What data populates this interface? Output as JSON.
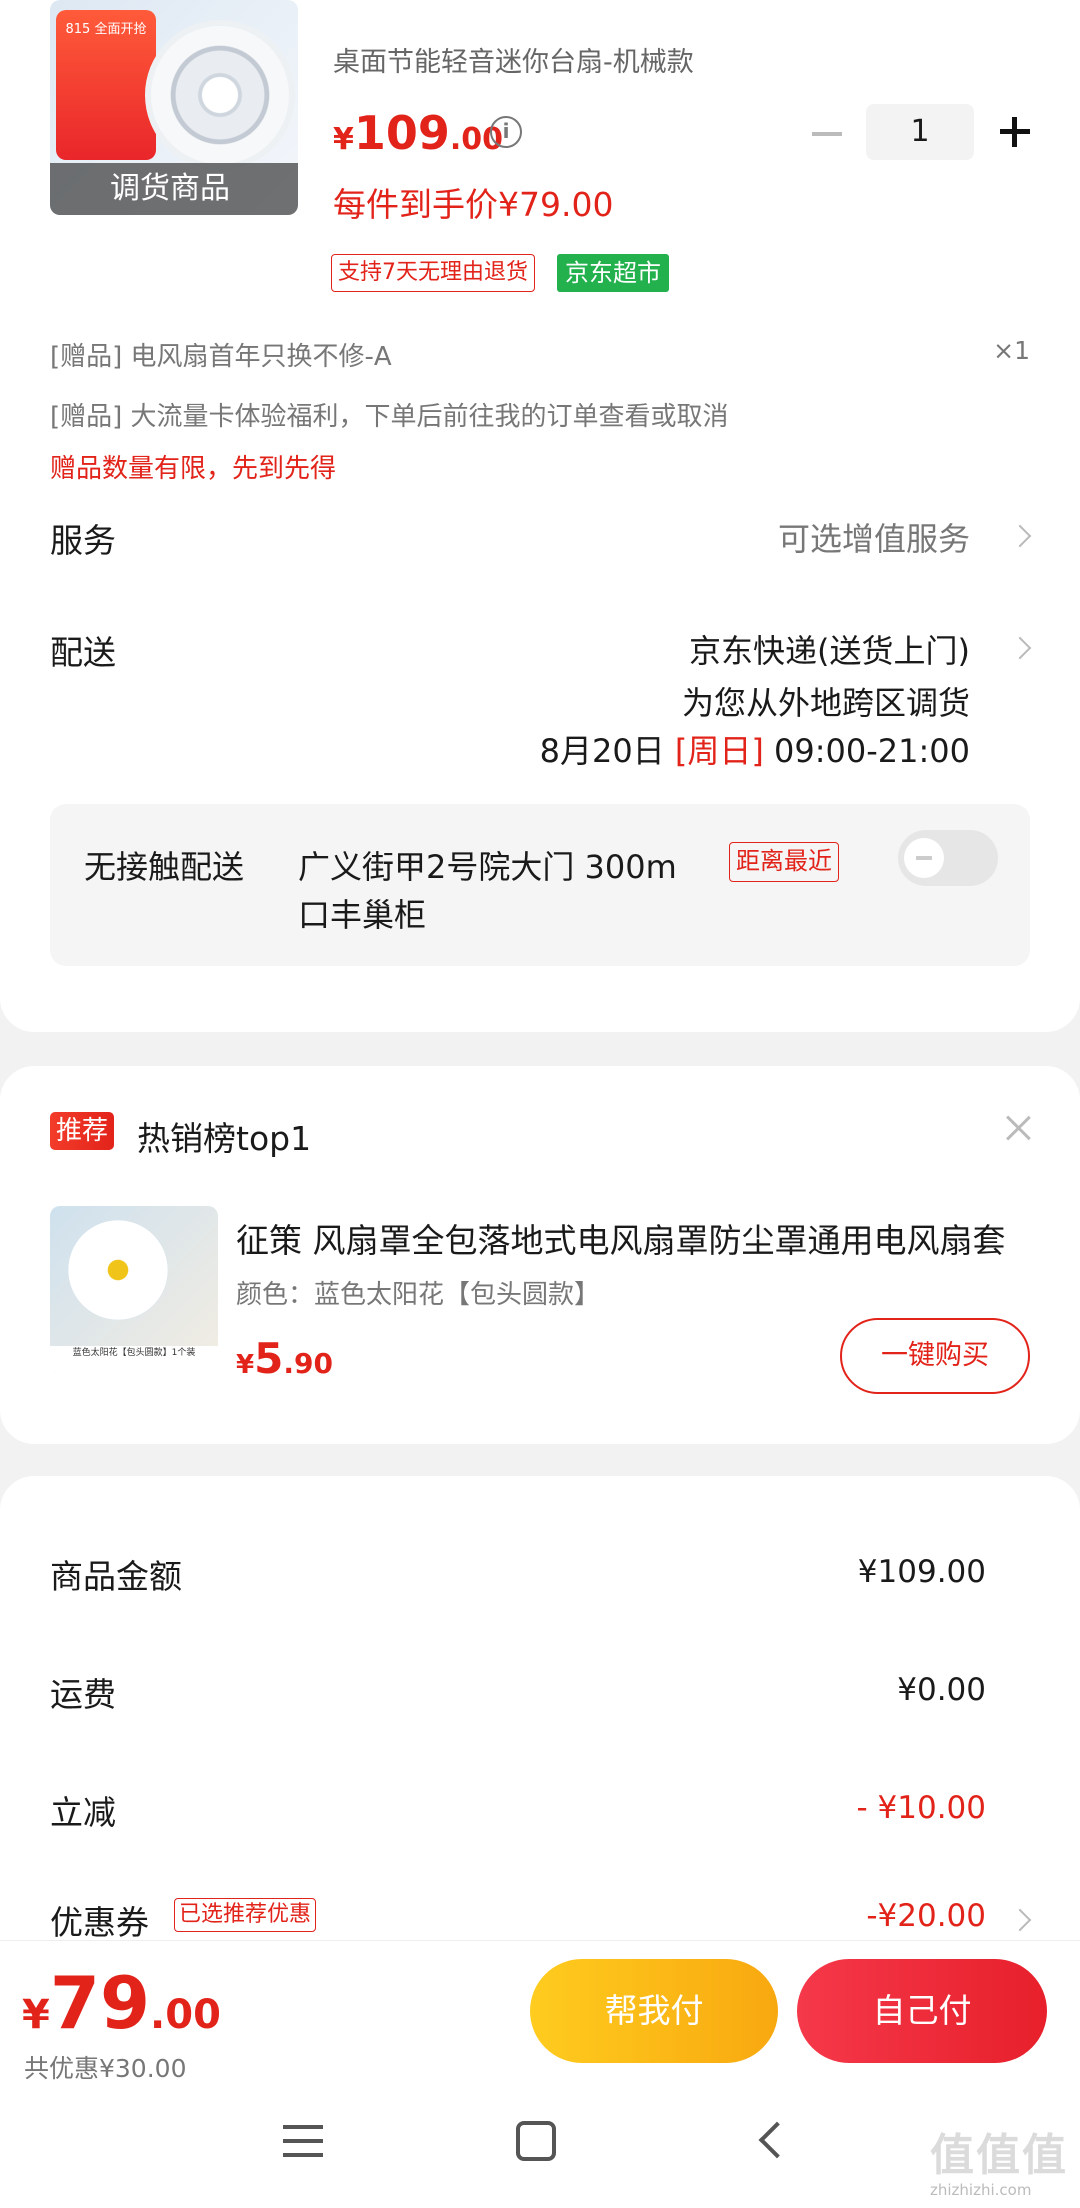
{
  "product": {
    "subtitle": "桌面节能轻音迷你台扇-机械款",
    "image_tag": "调货商品",
    "image_promo": "815 全面开抢",
    "price_currency": "¥",
    "price_int": "109",
    "price_dec": ".00",
    "quantity": "1",
    "final_price": "每件到手价¥79.00",
    "badge_return": "支持7天无理由退货",
    "badge_store": "京东超市"
  },
  "gifts": {
    "gift1": "[赠品]   电风扇首年只换不修-A",
    "gift1_count": "×1",
    "gift2": "[赠品] 大流量卡体验福利，下单后前往我的订单查看或取消",
    "warning": "赠品数量有限，先到先得"
  },
  "service": {
    "label": "服务",
    "value": "可选增值服务"
  },
  "delivery": {
    "label": "配送",
    "method": "京东快递(送货上门)",
    "note": "为您从外地跨区调货",
    "date": "8月20日",
    "weekday": "[周日]",
    "time": "09:00-21:00",
    "contactless_label": "无接触配送",
    "locker_line1": "广义街甲2号院大门  300m",
    "locker_line2": "口丰巢柜",
    "nearest_badge": "距离最近"
  },
  "recommend": {
    "tag": "推荐",
    "title": "热销榜top1",
    "name": "征策 风扇罩全包落地式电风扇罩防尘罩通用电风扇套",
    "attr": "颜色：蓝色太阳花【包头圆款】",
    "price_currency": "¥",
    "price_int": "5",
    "price_dec": ".90",
    "buy_label": "一键购买",
    "image_caption": "蓝色太阳花【包头圆款】1个装"
  },
  "summary": {
    "goods_label": "商品金额",
    "goods_value": "¥109.00",
    "shipping_label": "运费",
    "shipping_value": "¥0.00",
    "discount_label": "立减",
    "discount_value": "- ¥10.00",
    "coupon_label": "优惠券",
    "coupon_badge": "已选推荐优惠",
    "coupon_value": "-¥20.00"
  },
  "bottom": {
    "total_currency": "¥",
    "total_int": "79",
    "total_dec": ".00",
    "saved": "共优惠¥30.00",
    "help_pay": "帮我付",
    "self_pay": "自己付"
  },
  "watermark": {
    "text": "值值值",
    "url": "zhizhizhi.com"
  },
  "colors": {
    "accent_red": "#e2231a",
    "jd_green": "#22b14c",
    "help_pay_yellow": "#f8b20f"
  }
}
